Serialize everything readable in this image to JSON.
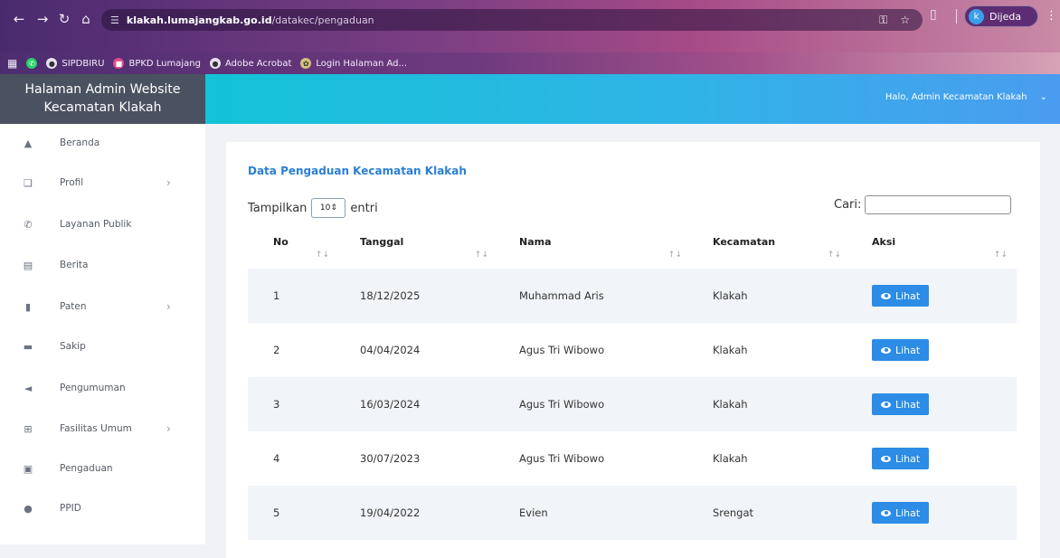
{
  "browser": {
    "url_host": "klakah.lumajangkab.go.id",
    "url_path": "/datakec/pengaduan",
    "profile_initial": "k",
    "profile_status": "Dijeda",
    "bookmarks": [
      "SIPDBIRU",
      "BPKD Lumajang",
      "Adobe Acrobat",
      "Login Halaman Ad..."
    ]
  },
  "sidebar": {
    "brand_line1": "Halaman Admin Website",
    "brand_line2": "Kecamatan Klakah",
    "items": [
      {
        "label": "Beranda",
        "icon": "home-icon",
        "has_submenu": false
      },
      {
        "label": "Profil",
        "icon": "copy-icon",
        "has_submenu": true
      },
      {
        "label": "Layanan Publik",
        "icon": "phone-icon",
        "has_submenu": false
      },
      {
        "label": "Berita",
        "icon": "newspaper-icon",
        "has_submenu": false
      },
      {
        "label": "Paten",
        "icon": "bookmark-icon",
        "has_submenu": true
      },
      {
        "label": "Sakip",
        "icon": "folder-icon",
        "has_submenu": false
      },
      {
        "label": "Pengumuman",
        "icon": "megaphone-icon",
        "has_submenu": false
      },
      {
        "label": "Fasilitas Umum",
        "icon": "grid-icon",
        "has_submenu": true
      },
      {
        "label": "Pengaduan",
        "icon": "message-icon",
        "has_submenu": false
      },
      {
        "label": "PPID",
        "icon": "info-icon",
        "has_submenu": false
      }
    ]
  },
  "topbar": {
    "greeting": "Halo, Admin Kecamatan Klakah"
  },
  "content": {
    "title": "Data Pengaduan Kecamatan Klakah",
    "show_label": "Tampilkan",
    "length_value": "10",
    "entries_label": "entri",
    "search_label": "Cari:",
    "search_value": "",
    "columns": [
      "No",
      "Tanggal",
      "Nama",
      "Kecamatan",
      "Aksi"
    ],
    "action_label": "Lihat",
    "rows": [
      {
        "no": "1",
        "tanggal": "18/12/2025",
        "nama": "Muhammad Aris",
        "kecamatan": "Klakah"
      },
      {
        "no": "2",
        "tanggal": "04/04/2024",
        "nama": "Agus Tri Wibowo",
        "kecamatan": "Klakah"
      },
      {
        "no": "3",
        "tanggal": "16/03/2024",
        "nama": "Agus Tri Wibowo",
        "kecamatan": "Klakah"
      },
      {
        "no": "4",
        "tanggal": "30/07/2023",
        "nama": "Agus Tri Wibowo",
        "kecamatan": "Klakah"
      },
      {
        "no": "5",
        "tanggal": "19/04/2022",
        "nama": "Evien",
        "kecamatan": "Srengat"
      }
    ]
  },
  "colors": {
    "accent": "#2c8ce6",
    "brand_bg": "#4a5160",
    "topbar_start": "#13c3d7",
    "topbar_end": "#4a9cf0"
  }
}
